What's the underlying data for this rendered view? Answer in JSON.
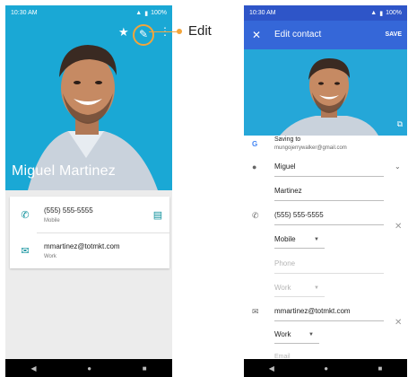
{
  "left_screen": {
    "status_time": "10:30 AM",
    "status_right": "100%",
    "contact_name": "Miguel Martinez",
    "phone_number": "(555) 555-5555",
    "phone_type": "Mobile",
    "email": "mmartinez@totmkt.com",
    "email_type": "Work"
  },
  "callout": {
    "label": "Edit"
  },
  "right_screen": {
    "status_time": "10:30 AM",
    "status_right": "100%",
    "appbar_title": "Edit contact",
    "save_label": "SAVE",
    "saving_to_label": "Saving to",
    "saving_account": "mungojerrywalker@gmail.com",
    "first_name": "Miguel",
    "last_name": "Martinez",
    "phone_value": "(555) 555-5555",
    "phone_type": "Mobile",
    "phone_placeholder": "Phone",
    "phone_type_placeholder": "Work",
    "email_value": "mmartinez@totmkt.com",
    "email_type": "Work",
    "email_placeholder": "Email"
  },
  "colors": {
    "hero_bg": "#1aa8d5",
    "edit_appbar": "#3567d8",
    "accent_teal": "#0b8f9a",
    "callout_orange": "#f3a53a"
  }
}
